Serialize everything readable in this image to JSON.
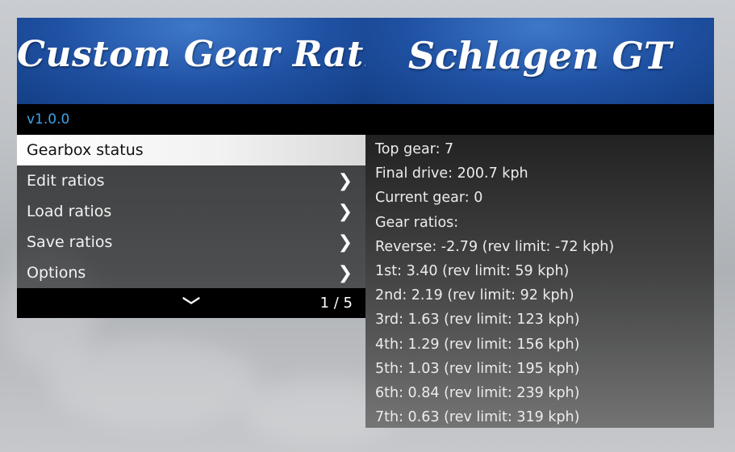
{
  "menu": {
    "title": "Custom Gear Ratios",
    "version": "v1.0.0",
    "items": [
      {
        "label": "Gearbox status",
        "has_submenu": false,
        "selected": true
      },
      {
        "label": "Edit ratios",
        "has_submenu": true,
        "selected": false
      },
      {
        "label": "Load ratios",
        "has_submenu": true,
        "selected": false
      },
      {
        "label": "Save ratios",
        "has_submenu": true,
        "selected": false
      },
      {
        "label": "Options",
        "has_submenu": true,
        "selected": false
      }
    ],
    "page_indicator": "1 / 5",
    "chevron_right": "❯",
    "chevron_down": "﹀"
  },
  "panel": {
    "title": "Schlagen GT",
    "lines": [
      "Top gear: 7",
      "Final drive: 200.7 kph",
      "Current gear: 0",
      "Gear ratios:",
      "Reverse: -2.79 (rev limit: -72 kph)",
      "1st: 3.40 (rev limit: 59 kph)",
      "2nd: 2.19 (rev limit: 92 kph)",
      "3rd: 1.63 (rev limit: 123 kph)",
      "4th: 1.29 (rev limit: 156 kph)",
      "5th: 1.03 (rev limit: 195 kph)",
      "6th: 0.84 (rev limit: 239 kph)",
      "7th: 0.63 (rev limit: 319 kph)"
    ]
  },
  "colors": {
    "header_blue": "#1f51a3",
    "version_blue": "#3fa2e8",
    "selected_bg": "#ffffff"
  }
}
